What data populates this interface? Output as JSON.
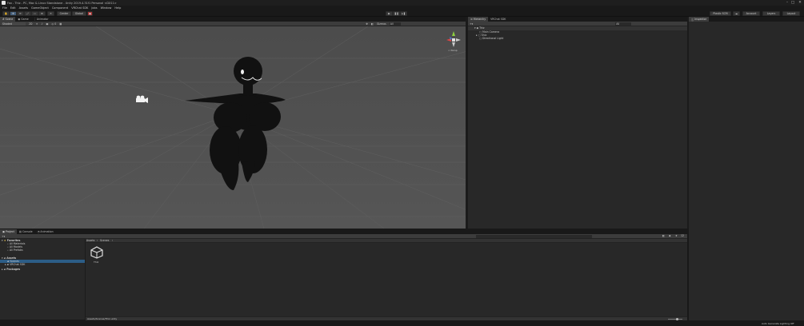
{
  "window": {
    "title": "Fax - Thiz - PC, Mac & Linux Standalone - Unity 2019.4.31f1 Personal <DX11>",
    "controls": [
      "–",
      "□",
      "✕"
    ]
  },
  "menu": [
    "File",
    "Edit",
    "Assets",
    "GameObject",
    "Component",
    "VRChat SDK",
    "Jobs",
    "Window",
    "Help"
  ],
  "toolbar": {
    "pivot_label": "Center",
    "space_label": "Global",
    "collab_label": "Plastic SCM",
    "account_label": "Account",
    "layers_label": "Layers",
    "layout_label": "Layout"
  },
  "scene_panel": {
    "tabs": [
      "Scene",
      "Game",
      "Animator"
    ],
    "shading_mode": "Shaded",
    "mode_2d": "2D",
    "gizmos_label": "Gizmos",
    "search_placeholder": "All",
    "persp_label": "< Persp"
  },
  "hierarchy_panel": {
    "tabs": [
      "Hierarchy",
      "VRChat SDK"
    ],
    "search_placeholder": "All",
    "scene_name": "Thiz",
    "items": [
      "Main Camera",
      "Shiz",
      "Directional Light"
    ]
  },
  "inspector_panel": {
    "tabs": [
      "Inspector"
    ]
  },
  "project_panel": {
    "tabs": [
      "Project",
      "Console",
      "Animation"
    ],
    "favorites_label": "Favorites",
    "favorites": [
      "All Materials",
      "All Models",
      "All Prefabs"
    ],
    "assets_label": "Assets",
    "assets_children": [
      "Scenes",
      "VRChat SDK"
    ],
    "packages_label": "Packages",
    "breadcrumb": [
      "Assets",
      "Scenes"
    ],
    "files": [
      {
        "name": "Thiz",
        "icon": "unity-logo-icon"
      }
    ],
    "status_path": "Assets/Scenes/Thiz.unity",
    "item_count": "12"
  },
  "statusbar": {
    "text": "Auto Generate Lighting Off"
  }
}
